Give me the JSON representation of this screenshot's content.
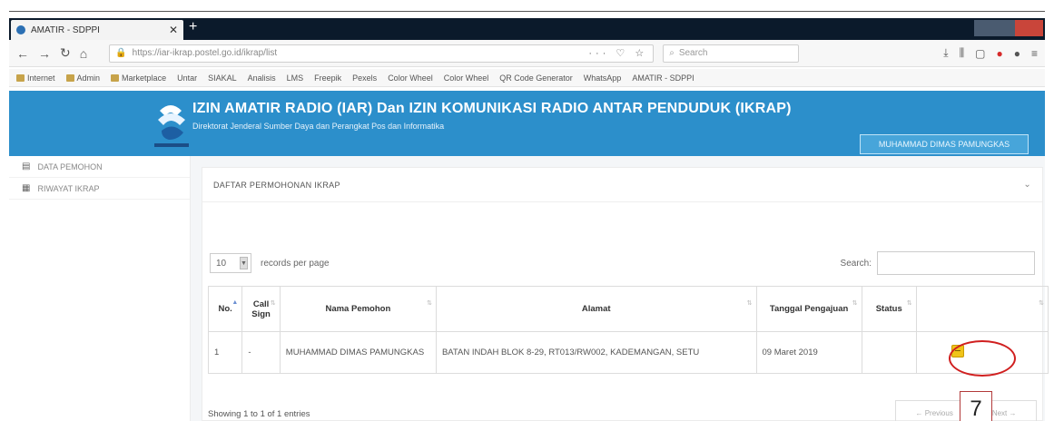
{
  "browser": {
    "tab_title": "AMATIR - SDPPI",
    "new_tab": "+",
    "url": "https://iar-ikrap.postel.go.id/ikrap/list",
    "search_placeholder": "Search"
  },
  "bookmarks": [
    "Internet",
    "Admin",
    "Marketplace",
    "Untar",
    "SIAKAL",
    "Analisis",
    "LMS",
    "Freepik",
    "Pexels",
    "Color Wheel",
    "Color Wheel",
    "QR Code Generator",
    "WhatsApp",
    "AMATIR - SDPPI"
  ],
  "header": {
    "title": "IZIN AMATIR RADIO (IAR) Dan IZIN KOMUNIKASI RADIO ANTAR PENDUDUK (IKRAP)",
    "subtitle": "Direktorat Jenderal Sumber Daya dan Perangkat Pos dan Informatika",
    "user_button": "MUHAMMAD DIMAS PAMUNGKAS"
  },
  "sidebar": {
    "items": [
      {
        "label": "DATA PEMOHON",
        "icon": "document-icon"
      },
      {
        "label": "RIWAYAT IKRAP",
        "icon": "history-icon"
      }
    ]
  },
  "panel": {
    "title": "DAFTAR PERMOHONAN IKRAP",
    "length_value": "10",
    "records_per_page": "records per page",
    "search_label": "Search:",
    "info": "Showing 1 to 1 of 1 entries",
    "pager_prev": "← Previous",
    "pager_next": "Next →"
  },
  "table": {
    "headers": [
      "No.",
      "Call Sign",
      "Nama Pemohon",
      "Alamat",
      "Tanggal Pengajuan",
      "Status",
      ""
    ],
    "rows": [
      {
        "no": "1",
        "call_sign": "-",
        "nama": "MUHAMMAD DIMAS PAMUNGKAS",
        "alamat": "BATAN INDAH BLOK 8-29, RT013/RW002, KADEMANGAN, SETU",
        "tanggal": "09 Maret 2019",
        "status": ""
      }
    ]
  },
  "annotation": {
    "callout_number": "7",
    "ring_color": "#d01f1f"
  },
  "colors": {
    "banner": "#2c8fcb",
    "edit_button": "#f0c419"
  }
}
